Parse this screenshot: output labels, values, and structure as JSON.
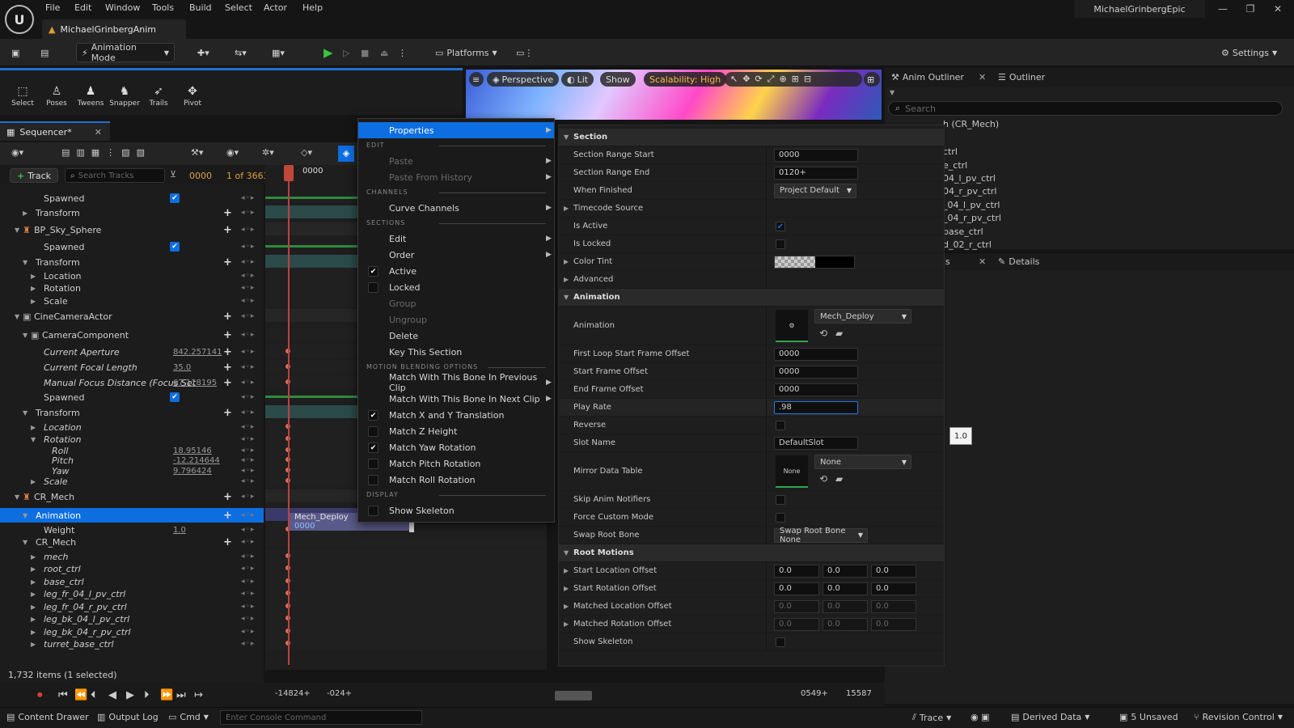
{
  "menubar": {
    "logo": "U",
    "items": [
      "File",
      "Edit",
      "Window",
      "Tools",
      "Build",
      "Select",
      "Actor",
      "Help"
    ],
    "doc_tab": "MichaelGrinbergAnim",
    "user": "MichaelGrinbergEpic"
  },
  "toolbar": {
    "animation_mode": "Animation Mode",
    "platforms": "Platforms",
    "settings": "Settings"
  },
  "modebar": {
    "items": [
      "Select",
      "Poses",
      "Tweens",
      "Snapper",
      "Trails",
      "Pivot"
    ]
  },
  "viewport": {
    "perspective": "Perspective",
    "lit": "Lit",
    "show": "Show",
    "scalability": "Scalability: High"
  },
  "outliner": {
    "tabs": [
      "Anim Outliner",
      "Outliner"
    ],
    "search_placeholder": "Search",
    "items": [
      "h (CR_Mech)",
      "ctrl",
      "e_ctrl",
      "04_l_pv_ctrl",
      "04_r_pv_ctrl",
      "_04_l_pv_ctrl",
      "_04_r_pv_ctrl",
      "base_ctrl",
      "d_02_r_ctrl"
    ]
  },
  "details": {
    "tabs": [
      "ls",
      "Details"
    ],
    "tooltip": "1.0"
  },
  "sequencer": {
    "tab": "Sequencer*",
    "track_button": "Track",
    "search_placeholder": "Search Tracks",
    "current_frame": "0000",
    "count": "1 of 3663",
    "ruler_label": "0000",
    "rows": [
      {
        "label": "Spawned",
        "indent": 2,
        "check": true
      },
      {
        "label": "Transform",
        "indent": 1,
        "arrow": "right",
        "plus": true
      },
      {
        "label": "BP_Sky_Sphere",
        "indent": 0,
        "arrow": "down",
        "plus": true,
        "icon": "actor"
      },
      {
        "label": "Spawned",
        "indent": 2,
        "check": true
      },
      {
        "label": "Transform",
        "indent": 1,
        "arrow": "down",
        "plus": true
      },
      {
        "label": "Location",
        "indent": 2,
        "arrow": "right"
      },
      {
        "label": "Rotation",
        "indent": 2,
        "arrow": "right"
      },
      {
        "label": "Scale",
        "indent": 2,
        "arrow": "right"
      },
      {
        "label": "CineCameraActor",
        "indent": 0,
        "arrow": "down",
        "plus": true,
        "icon": "camera"
      },
      {
        "label": "CameraComponent",
        "indent": 1,
        "arrow": "down",
        "plus": true,
        "icon": "camera"
      },
      {
        "label": "Current Aperture",
        "indent": 2,
        "value": "842.257141",
        "italic": true,
        "plus": true
      },
      {
        "label": "Current Focal Length",
        "indent": 2,
        "value": "35.0",
        "italic": true,
        "plus": true
      },
      {
        "label": "Manual Focus Distance (Focus Set",
        "indent": 2,
        "value": "67.118195",
        "italic": true,
        "plus": true
      },
      {
        "label": "Spawned",
        "indent": 2,
        "check": true
      },
      {
        "label": "Transform",
        "indent": 1,
        "arrow": "down",
        "plus": true
      },
      {
        "label": "Location",
        "indent": 2,
        "arrow": "right",
        "italic": true
      },
      {
        "label": "Rotation",
        "indent": 2,
        "arrow": "down",
        "italic": true
      },
      {
        "label": "Roll",
        "indent": 3,
        "value": "18.95146",
        "italic": true
      },
      {
        "label": "Pitch",
        "indent": 3,
        "value": "-12.214644",
        "italic": true
      },
      {
        "label": "Yaw",
        "indent": 3,
        "value": "9.796424",
        "italic": true
      },
      {
        "label": "Scale",
        "indent": 2,
        "arrow": "right",
        "italic": true
      },
      {
        "label": "CR_Mech",
        "indent": 0,
        "arrow": "down",
        "plus": true,
        "icon": "actor"
      },
      {
        "label": "Animation",
        "indent": 1,
        "arrow": "down",
        "plus": true,
        "selected": true
      },
      {
        "label": "Weight",
        "indent": 2,
        "value": "1.0"
      },
      {
        "label": "CR_Mech",
        "indent": 1,
        "arrow": "down",
        "plus": true
      },
      {
        "label": "mech",
        "indent": 2,
        "arrow": "right",
        "italic": true
      },
      {
        "label": "root_ctrl",
        "indent": 2,
        "arrow": "right",
        "italic": true
      },
      {
        "label": "base_ctrl",
        "indent": 2,
        "arrow": "right",
        "italic": true
      },
      {
        "label": "leg_fr_04_l_pv_ctrl",
        "indent": 2,
        "arrow": "right",
        "italic": true
      },
      {
        "label": "leg_fr_04_r_pv_ctrl",
        "indent": 2,
        "arrow": "right",
        "italic": true
      },
      {
        "label": "leg_bk_04_l_pv_ctrl",
        "indent": 2,
        "arrow": "right",
        "italic": true
      },
      {
        "label": "leg_bk_04_r_pv_ctrl",
        "indent": 2,
        "arrow": "right",
        "italic": true
      },
      {
        "label": "turret_base_ctrl",
        "indent": 2,
        "arrow": "right",
        "italic": true
      }
    ],
    "section_name": "Mech_Deploy",
    "section_frame": "0000",
    "status": "1,732 items (1 selected)",
    "transport": {
      "range_start": "-14824+",
      "view_start": "-024+",
      "view_end": "0549+",
      "range_end": "15587"
    }
  },
  "context_menu": {
    "properties": "Properties",
    "h_edit": "EDIT",
    "paste": "Paste",
    "paste_history": "Paste From History",
    "h_channels": "CHANNELS",
    "curve_channels": "Curve Channels",
    "h_sections": "SECTIONS",
    "edit": "Edit",
    "order": "Order",
    "active": "Active",
    "locked": "Locked",
    "group": "Group",
    "ungroup": "Ungroup",
    "delete": "Delete",
    "key_section": "Key This Section",
    "h_motion": "MOTION BLENDING OPTIONS",
    "match_prev": "Match With This Bone In Previous Clip",
    "match_next": "Match With This Bone In Next Clip",
    "match_xy": "Match X and Y Translation",
    "match_z": "Match Z Height",
    "match_yaw": "Match Yaw Rotation",
    "match_pitch": "Match Pitch Rotation",
    "match_roll": "Match Roll Rotation",
    "h_display": "DISPLAY",
    "show_skeleton": "Show Skeleton"
  },
  "properties": {
    "cat_section": "Section",
    "section_range_start": {
      "label": "Section Range Start",
      "value": "0000"
    },
    "section_range_end": {
      "label": "Section Range End",
      "value": "0120+"
    },
    "when_finished": {
      "label": "When Finished",
      "value": "Project Default"
    },
    "timecode_source": "Timecode Source",
    "is_active": "Is Active",
    "is_locked": "Is Locked",
    "color_tint": "Color Tint",
    "advanced": "Advanced",
    "cat_animation": "Animation",
    "animation": {
      "label": "Animation",
      "value": "Mech_Deploy"
    },
    "first_loop": {
      "label": "First Loop Start Frame Offset",
      "value": "0000"
    },
    "start_frame": {
      "label": "Start Frame Offset",
      "value": "0000"
    },
    "end_frame": {
      "label": "End Frame Offset",
      "value": "0000"
    },
    "play_rate": {
      "label": "Play Rate",
      "value": ".98"
    },
    "reverse": "Reverse",
    "slot_name": {
      "label": "Slot Name",
      "value": "DefaultSlot"
    },
    "mirror_table": {
      "label": "Mirror Data Table",
      "value": "None",
      "thumb": "None"
    },
    "skip_notifiers": "Skip Anim Notifiers",
    "force_custom": "Force Custom Mode",
    "swap_root": {
      "label": "Swap Root Bone",
      "value": "Swap Root Bone None"
    },
    "cat_root": "Root Motions",
    "start_loc": {
      "label": "Start Location Offset",
      "x": "0.0",
      "y": "0.0",
      "z": "0.0"
    },
    "start_rot": {
      "label": "Start Rotation Offset",
      "x": "0.0",
      "y": "0.0",
      "z": "0.0"
    },
    "matched_loc": {
      "label": "Matched Location Offset",
      "x": "0.0",
      "y": "0.0",
      "z": "0.0"
    },
    "matched_rot": {
      "label": "Matched Rotation Offset",
      "x": "0.0",
      "y": "0.0",
      "z": "0.0"
    },
    "show_skeleton": "Show Skeleton"
  },
  "bottom": {
    "content_drawer": "Content Drawer",
    "output_log": "Output Log",
    "cmd": "Cmd",
    "console_placeholder": "Enter Console Command",
    "trace": "Trace",
    "derived_data": "Derived Data",
    "unsaved": "5 Unsaved",
    "revision": "Revision Control"
  }
}
